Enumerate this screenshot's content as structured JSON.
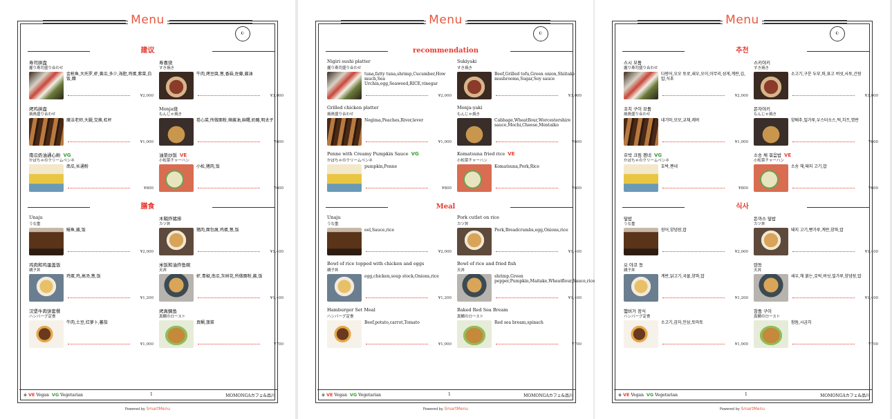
{
  "pages": [
    {
      "title": "Menu",
      "halal_label": "HALAL",
      "sections": [
        {
          "heading": "建议",
          "items": [
            {
              "name": "寿司拼盘",
              "sub": "握り寿司盛り合わせ",
              "ingredients": "金枪鱼,大托罗,虾,黄瓜,多少,海胆,鸡蛋,紫菜,白饭,醋",
              "price": "¥2,000",
              "badge": "",
              "photo": "sushi"
            },
            {
              "name": "寿喜烧",
              "sub": "すき焼き",
              "ingredients": "牛肉,烤豆腐,葱,香菇,佐藤,酱油",
              "price": "¥3,000",
              "badge": "",
              "photo": "suki"
            },
            {
              "name": "烤鸡拼盘",
              "sub": "焼鳥盛り合わせ",
              "ingredients": "魔法老师,大腿,交换,杠杆",
              "price": "¥1,000",
              "badge": "",
              "photo": "chick"
            },
            {
              "name": "Monja烧",
              "sub": "もんじゃ焼き",
              "ingredients": "卷心菜,所做面粉,辣酱油,麻糬,奶酪,明太子",
              "price": "¥600",
              "badge": "",
              "photo": "monja"
            },
            {
              "name": "南瓜奶油通心粉",
              "sub": "かぼちゃのクリームペンネ",
              "ingredients": "南瓜,长通粉",
              "price": "¥800",
              "badge": "VG",
              "photo": "penne"
            },
            {
              "name": "油菜炒饭",
              "sub": "小松菜チャーハン",
              "ingredients": "小松,猪肉,饭",
              "price": "¥600",
              "badge": "VE",
              "photo": "fried"
            }
          ]
        },
        {
          "heading": "膳食",
          "items": [
            {
              "name": "Unaju",
              "sub": "うな重",
              "ingredients": "鳗鱼,酱,饭",
              "price": "¥2,000",
              "badge": "",
              "photo": "unaju"
            },
            {
              "name": "木鞘炸猪排",
              "sub": "カツ丼",
              "ingredients": "猪肉,面包屑,鸡蛋,葱,饭",
              "price": "¥1,400",
              "badge": "",
              "photo": "katsu"
            },
            {
              "name": "鸡肉和鸡蛋盖饭",
              "sub": "親子丼",
              "ingredients": "鸡蛋,鸡,高汤,葱,饭",
              "price": "¥1,200",
              "badge": "",
              "photo": "oyako"
            },
            {
              "name": "米饭和油炸鱼碗",
              "sub": "天丼",
              "ingredients": "虾,青椒,南瓜,灰树花,所做面粉,酱,饭",
              "price": "¥1,400",
              "badge": "",
              "photo": "tendon"
            },
            {
              "name": "汉堡牛肉饼套餐",
              "sub": "ハンバーグ定食",
              "ingredients": "牛肉,土豆,红萝卜,蕃茄",
              "price": "¥1,000",
              "badge": "",
              "photo": "hamb"
            },
            {
              "name": "烤真鲷鱼",
              "sub": "真鯛のロースト",
              "ingredients": "真鲷,菠菜",
              "price": "¥700",
              "badge": "",
              "photo": "bream"
            }
          ]
        }
      ],
      "footer": {
        "mark": "※",
        "ve": "VE",
        "vegan": "Vegan",
        "vg": "VG",
        "vegetarian": "Vegetarian",
        "page": "1",
        "shop": "MOMONGAカフェ&品川"
      },
      "powered": {
        "prefix": "Powered by",
        "brand": "SmartMenu"
      }
    },
    {
      "title": "Menu",
      "halal_label": "HALAL",
      "sections": [
        {
          "heading": "recommendation",
          "items": [
            {
              "name": "Nigiri sushi platter",
              "sub": "握り寿司盛り合わせ",
              "ingredients": "tuna,fatty tuna,shrimp,Cucumber,How much,Sea Urchin,egg,Seaweed,RICE,vinegar",
              "price": "¥2,000",
              "badge": "",
              "photo": "sushi"
            },
            {
              "name": "Sukiyaki",
              "sub": "すき焼き",
              "ingredients": "Beef,Grilled tofu,Green onion,Shiitake mushrooms,Sugar,Soy sauce",
              "price": "¥3,000",
              "badge": "",
              "photo": "suki"
            },
            {
              "name": "Grilled chicken platter",
              "sub": "焼鳥盛り合わせ",
              "ingredients": "Negima,Peaches,River,lever",
              "price": "¥1,000",
              "badge": "",
              "photo": "chick"
            },
            {
              "name": "Monja-yaki",
              "sub": "もんじゃ焼き",
              "ingredients": "Cabbage,Wheatflour,Worcestershire sauce,Mochi,Cheese,Mentaiko",
              "price": "¥600",
              "badge": "",
              "photo": "monja"
            },
            {
              "name": "Penne with Creamy Pumpkin Sauce",
              "sub": "かぼちゃのクリームペンネ",
              "ingredients": "pumpkin,Penne",
              "price": "¥800",
              "badge": "VG",
              "photo": "penne"
            },
            {
              "name": "Komatsuna fried rice",
              "sub": "小松菜チャーハン",
              "ingredients": "Komatsuna,Pork,Rice",
              "price": "¥600",
              "badge": "VE",
              "photo": "fried"
            }
          ]
        },
        {
          "heading": "Meal",
          "items": [
            {
              "name": "Unaju",
              "sub": "うな重",
              "ingredients": "eel,Sauce,rice",
              "price": "¥2,000",
              "badge": "",
              "photo": "unaju"
            },
            {
              "name": "Pork cutlet on rice",
              "sub": "カツ丼",
              "ingredients": "Pork,Breadcrumbs,egg,Onions,rice",
              "price": "¥1,400",
              "badge": "",
              "photo": "katsu"
            },
            {
              "name": "Bowl of rice topped with chicken and eggs",
              "sub": "親子丼",
              "ingredients": "egg,chicken,soup stock,Onions,rice",
              "price": "¥1,200",
              "badge": "",
              "photo": "oyako"
            },
            {
              "name": "Bowl of rice and fried fish",
              "sub": "天丼",
              "ingredients": "shrimp,Green pepper,Pumpkin,Maitake,Wheatflour,Sauce,rice",
              "price": "¥1,400",
              "badge": "",
              "photo": "tendon"
            },
            {
              "name": "Hamburger Set Meal",
              "sub": "ハンバーグ定食",
              "ingredients": "Beef,potato,carrot,Tomato",
              "price": "¥1,000",
              "badge": "",
              "photo": "hamb"
            },
            {
              "name": "Baked Red Sea Bream",
              "sub": "真鯛のロースト",
              "ingredients": "Red sea bream,spinach",
              "price": "¥700",
              "badge": "",
              "photo": "bream"
            }
          ]
        }
      ],
      "footer": {
        "mark": "※",
        "ve": "VE",
        "vegan": "Vegan",
        "vg": "VG",
        "vegetarian": "Vegetarian",
        "page": "1",
        "shop": "MOMONGAカフェ&品川"
      },
      "powered": {
        "prefix": "Powered by",
        "brand": "SmartMenu"
      }
    },
    {
      "title": "Menu",
      "halal_label": "HALAL",
      "sections": [
        {
          "heading": "추천",
          "items": [
            {
              "name": "스시 모둠",
              "sub": "握り寿司盛り合わせ",
              "ingredients": "다랑어,오오 토로,새우,오이,아무리,성게,계란,김,밥,식초",
              "price": "¥2,000",
              "badge": "",
              "photo": "sushi"
            },
            {
              "name": "스키야키",
              "sub": "すき焼き",
              "ingredients": "소고기,구운 두부,파,표고 버섯,사토,간장",
              "price": "¥3,000",
              "badge": "",
              "photo": "suki"
            },
            {
              "name": "꼬치 구이 모둠",
              "sub": "焼鳥盛り合わせ",
              "ingredients": "네기마,모모,교체,레버",
              "price": "¥1,000",
              "badge": "",
              "photo": "chick"
            },
            {
              "name": "몬자야키",
              "sub": "もんじゃ焼き",
              "ingredients": "양배추,밀가루,우스터소스,떡,치즈,명란",
              "price": "¥600",
              "badge": "",
              "photo": "monja"
            },
            {
              "name": "호박 크림 펜네",
              "sub": "かぼちゃのクリームペンネ",
              "ingredients": "호박,펜네",
              "price": "¥800",
              "badge": "VG",
              "photo": "penne"
            },
            {
              "name": "소송 채 볶음밥",
              "sub": "小松菜チャーハン",
              "ingredients": "소송 채,돼지 고기,밥",
              "price": "¥600",
              "badge": "VE",
              "photo": "fried"
            }
          ]
        },
        {
          "heading": "식사",
          "items": [
            {
              "name": "덮밥",
              "sub": "うな重",
              "ingredients": "장어,양념장,밥",
              "price": "¥2,000",
              "badge": "",
              "photo": "unaju"
            },
            {
              "name": "돈까스 덮밥",
              "sub": "カツ丼",
              "ingredients": "돼지 고기,빵가루,계란,양파,밥",
              "price": "¥1,400",
              "badge": "",
              "photo": "katsu"
            },
            {
              "name": "오 야코 동",
              "sub": "親子丼",
              "ingredients": "계란,닭고기,국물,양파,밥",
              "price": "¥1,200",
              "badge": "",
              "photo": "oyako"
            },
            {
              "name": "텐동",
              "sub": "天丼",
              "ingredients": "새우,해 붉는,호박,버섯,밀가루,양념장,밥",
              "price": "¥1,400",
              "badge": "",
              "photo": "tendon"
            },
            {
              "name": "햄버거 정식",
              "sub": "ハンバーグ定食",
              "ingredients": "소고기,감자,인삼,토마토",
              "price": "¥1,000",
              "badge": "",
              "photo": "hamb"
            },
            {
              "name": "참돔 구이",
              "sub": "真鯛のロースト",
              "ingredients": "참돔,시금치",
              "price": "¥700",
              "badge": "",
              "photo": "bream"
            }
          ]
        }
      ],
      "footer": {
        "mark": "※",
        "ve": "VE",
        "vegan": "Vegan",
        "vg": "VG",
        "vegetarian": "Vegetarian",
        "page": "1",
        "shop": "MOMONGAカフェ&品川"
      },
      "powered": {
        "prefix": "Powered by",
        "brand": "SmartMenu"
      }
    }
  ],
  "colors": {
    "accent": "#e8573c",
    "section_red": "#e53a2f",
    "vegetarian_green": "#3a9a3a",
    "rule": "#333333"
  }
}
